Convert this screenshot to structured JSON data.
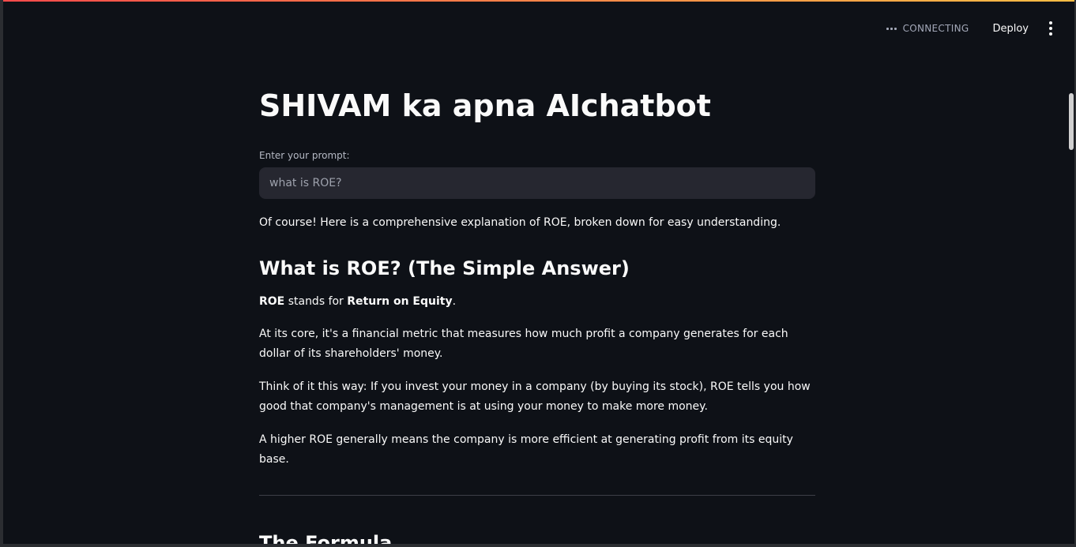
{
  "toolbar": {
    "status": "CONNECTING",
    "deploy_label": "Deploy"
  },
  "main": {
    "title": "SHIVAM ka apna AIchatbot",
    "prompt_label": "Enter your prompt:",
    "prompt_value": "what is ROE?",
    "response": {
      "intro": "Of course! Here is a comprehensive explanation of ROE, broken down for easy understanding.",
      "heading1": "What is ROE? (The Simple Answer)",
      "p1_bold1": "ROE",
      "p1_text1": " stands for ",
      "p1_bold2": "Return on Equity",
      "p1_text2": ".",
      "p2": "At its core, it's a financial metric that measures how much profit a company generates for each dollar of its shareholders' money.",
      "p3": "Think of it this way: If you invest your money in a company (by buying its stock), ROE tells you how good that company's management is at using your money to make more money.",
      "p4": "A higher ROE generally means the company is more efficient at generating profit from its equity base.",
      "heading2": "The Formula"
    }
  },
  "colors": {
    "background": "#0e1117",
    "input_background": "#262730",
    "accent_gradient_start": "#ff4b4b",
    "accent_gradient_end": "#ffbd45"
  }
}
